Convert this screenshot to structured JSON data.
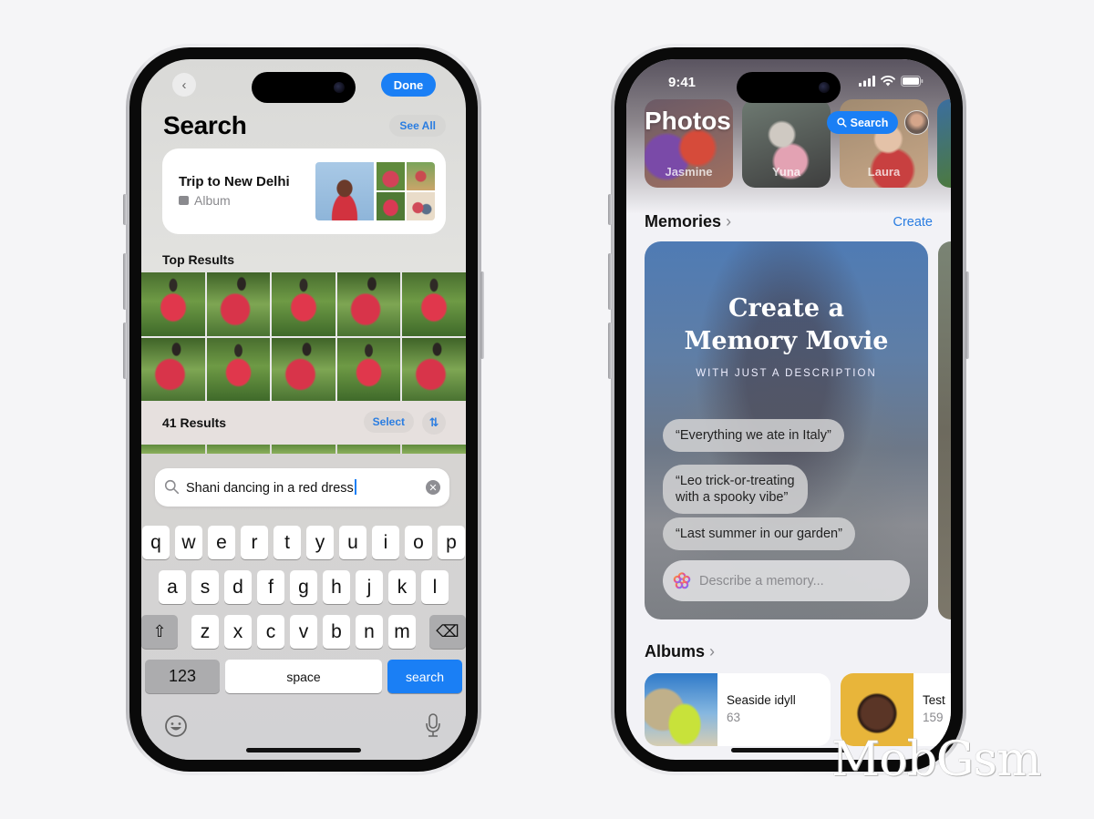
{
  "left_phone": {
    "nav": {
      "back_icon": "chevron-left-icon",
      "done_label": "Done"
    },
    "title": "Search",
    "see_all_label": "See All",
    "album_result": {
      "name": "Trip to New Delhi",
      "type": "Album",
      "type_icon": "album-stack-icon"
    },
    "top_results_label": "Top Results",
    "top_results_count": 10,
    "results": {
      "count_label": "41 Results",
      "select_label": "Select",
      "sort_icon": "sort-arrows-icon",
      "sort_glyph": "⇅"
    },
    "search_field": {
      "query": "Shani dancing in a red dress",
      "search_icon": "magnifying-glass-icon",
      "clear_icon": "clear-circle-icon",
      "clear_glyph": "✕"
    },
    "keyboard": {
      "row1": [
        "q",
        "w",
        "e",
        "r",
        "t",
        "y",
        "u",
        "i",
        "o",
        "p"
      ],
      "row2": [
        "a",
        "s",
        "d",
        "f",
        "g",
        "h",
        "j",
        "k",
        "l"
      ],
      "row3": [
        "z",
        "x",
        "c",
        "v",
        "b",
        "n",
        "m"
      ],
      "shift_glyph": "⇧",
      "delete_glyph": "⌫",
      "numbers_label": "123",
      "space_label": "space",
      "return_label": "search"
    }
  },
  "right_phone": {
    "status_bar": {
      "time": "9:41"
    },
    "title": "Photos",
    "search_button_label": "Search",
    "people": [
      {
        "name": "Jasmine"
      },
      {
        "name": "Yuna"
      },
      {
        "name": "Laura"
      }
    ],
    "memories": {
      "header": "Memories",
      "chevron": "›",
      "create_label": "Create",
      "card": {
        "title_line1": "Create a",
        "title_line2": "Memory Movie",
        "subtitle": "WITH JUST A DESCRIPTION",
        "prompts": [
          "“Everything we ate in Italy”",
          "“Leo trick-or-treating with a spooky vibe”",
          "“Last summer in our garden”"
        ],
        "prompt2_line1": "“Leo trick-or-treating",
        "prompt2_line2": "with a spooky vibe”",
        "input_placeholder": "Describe a memory...",
        "input_icon": "apple-intelligence-icon"
      }
    },
    "albums": {
      "header": "Albums",
      "chevron": "›",
      "items": [
        {
          "name": "Seaside idyll",
          "count": "63"
        },
        {
          "name": "Test",
          "count": "159"
        }
      ]
    }
  },
  "watermark": "MobGsm",
  "colors": {
    "accent_blue": "#1a7ff5",
    "link_blue": "#2a7de1"
  }
}
